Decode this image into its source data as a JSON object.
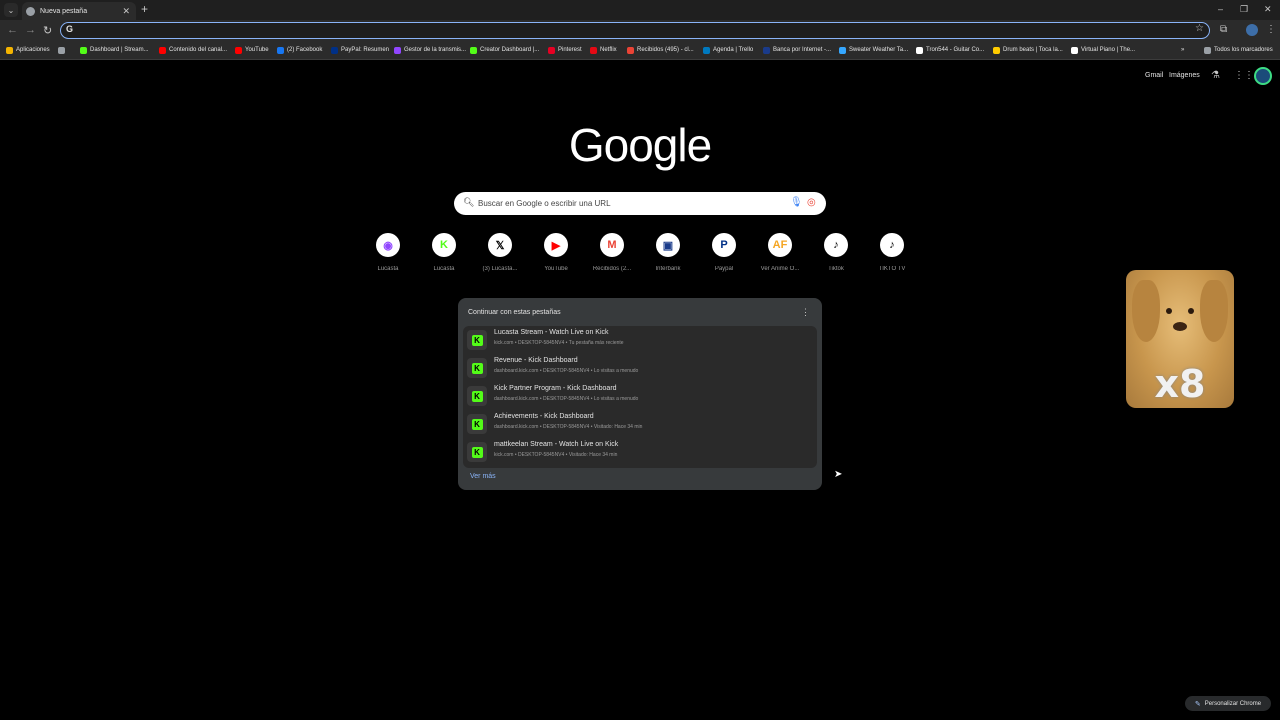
{
  "tab": {
    "title": "Nueva pestaña"
  },
  "window_controls": {
    "minimize": "–",
    "restore": "❐",
    "close": "✕"
  },
  "bookmarks": [
    {
      "label": "Aplicaciones",
      "color": "#f4b400"
    },
    {
      "label": "",
      "color": "#9aa0a6"
    },
    {
      "label": "Dashboard | Stream...",
      "color": "#53fc18"
    },
    {
      "label": "Contenido del canal...",
      "color": "#ff0000"
    },
    {
      "label": "YouTube",
      "color": "#ff0000"
    },
    {
      "label": "(2) Facebook",
      "color": "#1877f2"
    },
    {
      "label": "PayPal: Resumen",
      "color": "#003087"
    },
    {
      "label": "Gestor de la transmis...",
      "color": "#9146ff"
    },
    {
      "label": "Creator Dashboard |...",
      "color": "#53fc18"
    },
    {
      "label": "Pinterest",
      "color": "#e60023"
    },
    {
      "label": "Netflix",
      "color": "#e50914"
    },
    {
      "label": "Recibidos (495) - cl...",
      "color": "#ea4335"
    },
    {
      "label": "Agenda | Trello",
      "color": "#0079bf"
    },
    {
      "label": "Banca por Internet -...",
      "color": "#1a3b8a"
    },
    {
      "label": "Sweater Weather Ta...",
      "color": "#35a7ff"
    },
    {
      "label": "Tron544 - Guitar Co...",
      "color": "#ffffff"
    },
    {
      "label": "Drum beats | Toca la...",
      "color": "#ffcc00"
    },
    {
      "label": "Virtual Piano | The...",
      "color": "#ffffff"
    },
    {
      "label": "Todos los marcadores",
      "color": "#9aa0a6"
    }
  ],
  "top_links": {
    "gmail": "Gmail",
    "images": "Imágenes"
  },
  "logo": "Google",
  "search": {
    "placeholder": "Buscar en Google o escribir una URL"
  },
  "shortcuts": [
    {
      "label": "Lucasta",
      "glyph": "◉",
      "color": "#9146ff"
    },
    {
      "label": "Lucasta",
      "glyph": "K",
      "color": "#53fc18"
    },
    {
      "label": "(3) Lucasta...",
      "glyph": "𝕏",
      "color": "#000000"
    },
    {
      "label": "YouTube",
      "glyph": "▶",
      "color": "#ff0000"
    },
    {
      "label": "Recibidos (2...",
      "glyph": "M",
      "color": "#ea4335"
    },
    {
      "label": "Interbank",
      "glyph": "▣",
      "color": "#1a3b8a"
    },
    {
      "label": "Paypal",
      "glyph": "P",
      "color": "#003087"
    },
    {
      "label": "Ver Anime O...",
      "glyph": "AF",
      "color": "#f5a623"
    },
    {
      "label": "Tiktok",
      "glyph": "♪",
      "color": "#000000"
    },
    {
      "label": "TIKTO TV",
      "glyph": "♪",
      "color": "#000000"
    }
  ],
  "continue_card": {
    "title": "Continuar con estas pestañas",
    "rows": [
      {
        "title": "Lucasta Stream - Watch Live on Kick",
        "sub": "kick.com • DESKTOP-5845NV4 • Tu pestaña más reciente"
      },
      {
        "title": "Revenue - Kick Dashboard",
        "sub": "dashboard.kick.com • DESKTOP-5845NV4 • Lo visitas a menudo"
      },
      {
        "title": "Kick Partner Program - Kick Dashboard",
        "sub": "dashboard.kick.com • DESKTOP-5845NV4 • Lo visitas a menudo"
      },
      {
        "title": "Achievements - Kick Dashboard",
        "sub": "dashboard.kick.com • DESKTOP-5845NV4 • Visitado: Hace 34 min"
      },
      {
        "title": "mattkeelan Stream - Watch Live on Kick",
        "sub": "kick.com • DESKTOP-5845NV4 • Visitado: Hace 34 min"
      }
    ],
    "more": "Ver más"
  },
  "overlay": {
    "multiplier": "x8"
  },
  "customize": {
    "label": "Personalizar Chrome"
  }
}
